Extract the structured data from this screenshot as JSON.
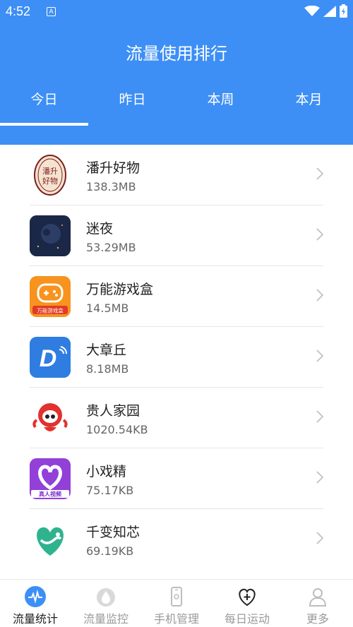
{
  "status": {
    "time": "4:52",
    "a_badge": "A"
  },
  "title": "流量使用排行",
  "tabs": [
    "今日",
    "昨日",
    "本周",
    "本月"
  ],
  "active_tab": "今日",
  "apps": [
    {
      "name": "潘升好物",
      "size": "138.3MB",
      "icon": "pansheng-haowu-icon",
      "icon_text": "潘升好物"
    },
    {
      "name": "迷夜",
      "size": "53.29MB",
      "icon": "miye-icon"
    },
    {
      "name": "万能游戏盒",
      "size": "14.5MB",
      "icon": "gamepad-box-icon",
      "icon_text": "万能游戏盒"
    },
    {
      "name": "大章丘",
      "size": "8.18MB",
      "icon": "dazhangqiu-icon",
      "icon_text": "D"
    },
    {
      "name": "贵人家园",
      "size": "1020.54KB",
      "icon": "guiren-mascot-icon"
    },
    {
      "name": "小戏精",
      "size": "75.17KB",
      "icon": "xiaoxijing-icon",
      "icon_text": "真人视频"
    },
    {
      "name": "千变知芯",
      "size": "69.19KB",
      "icon": "qianbian-heart-icon"
    }
  ],
  "nav": [
    {
      "label": "流量统计",
      "icon": "pulse-icon",
      "active": true
    },
    {
      "label": "流量监控",
      "icon": "droplet-icon",
      "active": false
    },
    {
      "label": "手机管理",
      "icon": "phone-icon",
      "active": false
    },
    {
      "label": "每日运动",
      "icon": "heart-plus-icon",
      "active": false
    },
    {
      "label": "更多",
      "icon": "person-icon",
      "active": false
    }
  ],
  "colors": {
    "header": "#3d8ff5",
    "accent": "#3d8ff5"
  }
}
